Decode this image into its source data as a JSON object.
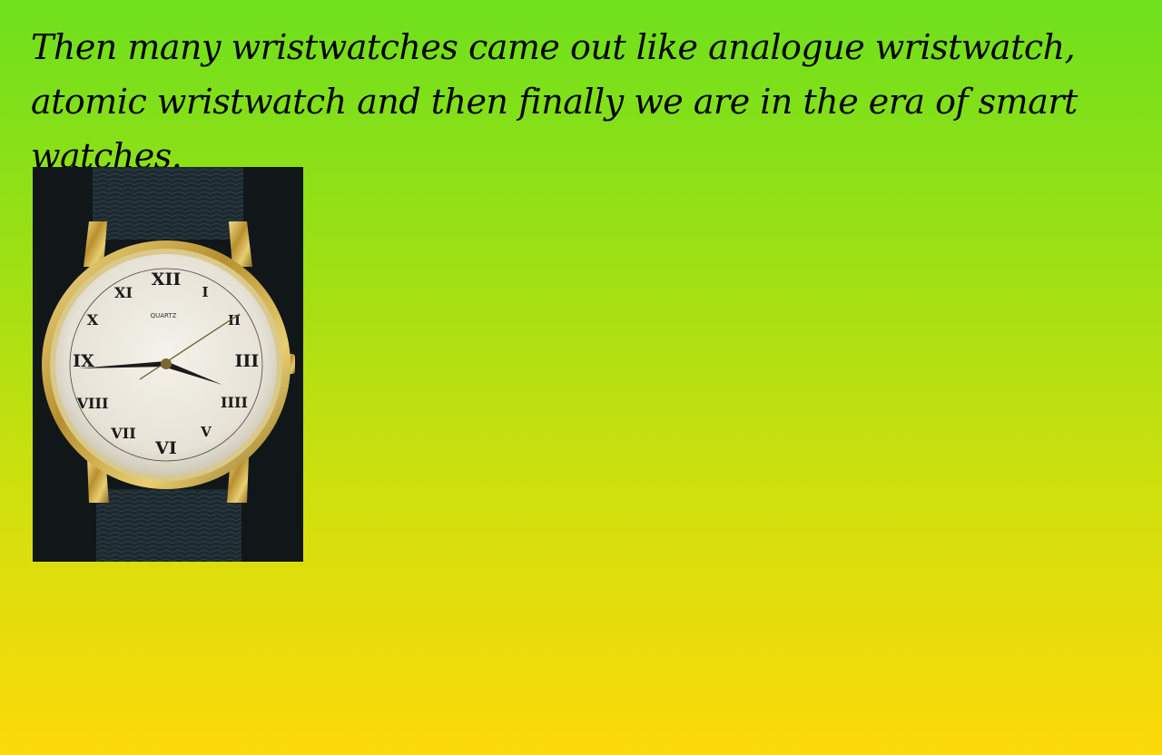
{
  "slide": {
    "text": "Then many wristwatches came out like analogue wristwatch, atomic wristwatch and then finally we are in the era of smart watches."
  },
  "watch_image": {
    "dial_brand": "QUARTZ",
    "numerals": [
      "XII",
      "I",
      "II",
      "III",
      "IIII",
      "V",
      "VI",
      "VII",
      "VIII",
      "IX",
      "X",
      "XI"
    ]
  }
}
